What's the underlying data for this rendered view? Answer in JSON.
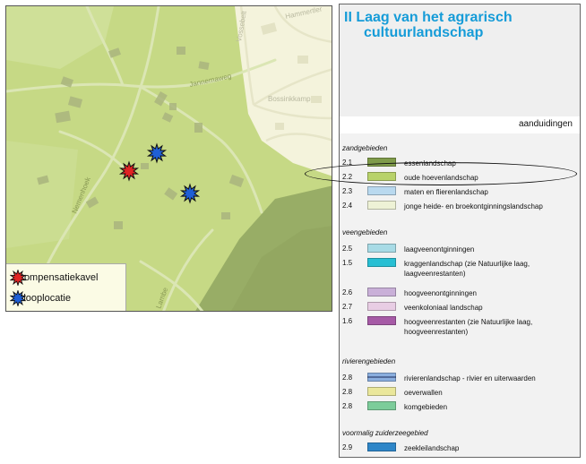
{
  "map": {
    "roads": [
      "Vossebelt",
      "Hammertler",
      "Jannemaweg",
      "Bossinkkamp",
      "Nemenhoek",
      "Lambe"
    ],
    "legend": [
      {
        "label": "Compensatiekavel",
        "color": "#e02424"
      },
      {
        "label": "Slooplocatie",
        "color": "#1f5fd6"
      }
    ],
    "colors": {
      "agrarisch": "#c6d985",
      "urban": "#f4f3dc",
      "essen": "#98ad66",
      "buildings": "#aab57e"
    }
  },
  "legend": {
    "title_line1": "II Laag van het agrarisch",
    "title_line2": "cultuurlandschap",
    "header": "aanduidingen",
    "sections": [
      {
        "title": "zandgebieden",
        "items": [
          {
            "code": "2.1",
            "label": "essenlandschap",
            "color": "#7f9b4a"
          },
          {
            "code": "2.2",
            "label": "oude hoevenlandschap",
            "color": "#b8d26a"
          },
          {
            "code": "2.3",
            "label": "maten en flierenlandschap",
            "color": "#b9d9ef"
          },
          {
            "code": "2.4",
            "label": "jonge heide- en broekontginningslandschap",
            "color": "#eef2d6"
          }
        ]
      },
      {
        "title": "veengebieden",
        "items": [
          {
            "code": "2.5",
            "label": "laagveenontginningen",
            "color": "#a8dbe6"
          },
          {
            "code": "1.5",
            "label": "kraggenlandschap  (zie Natuurlijke laag,",
            "label2": "laagveenrestanten)",
            "color": "#27bfd3"
          },
          {
            "code": "2.6",
            "label": "hoogveenontginningen",
            "color": "#c9b0d8"
          },
          {
            "code": "2.7",
            "label": "veenkoloniaal landschap",
            "color": "#e8cde4"
          },
          {
            "code": "1.6",
            "label": "hoogveenrestanten (zie Natuurlijke laag,",
            "label2": "hoogveenrestanten)",
            "color": "#a65aa6"
          }
        ]
      },
      {
        "title": "rivierengebieden",
        "items": [
          {
            "code": "2.8",
            "label": "rivierenlandschap - rivier en uiterwaarden",
            "color": "#8aaede"
          },
          {
            "code": "2.8",
            "label": "oeverwallen",
            "color": "#eae79b"
          },
          {
            "code": "2.8",
            "label": "komgebieden",
            "color": "#7ccc9a"
          }
        ]
      },
      {
        "title": "voormalig zuiderzeegebied",
        "items": [
          {
            "code": "2.9",
            "label": "zeekleilandschap",
            "color": "#2e86c8"
          }
        ]
      }
    ]
  }
}
